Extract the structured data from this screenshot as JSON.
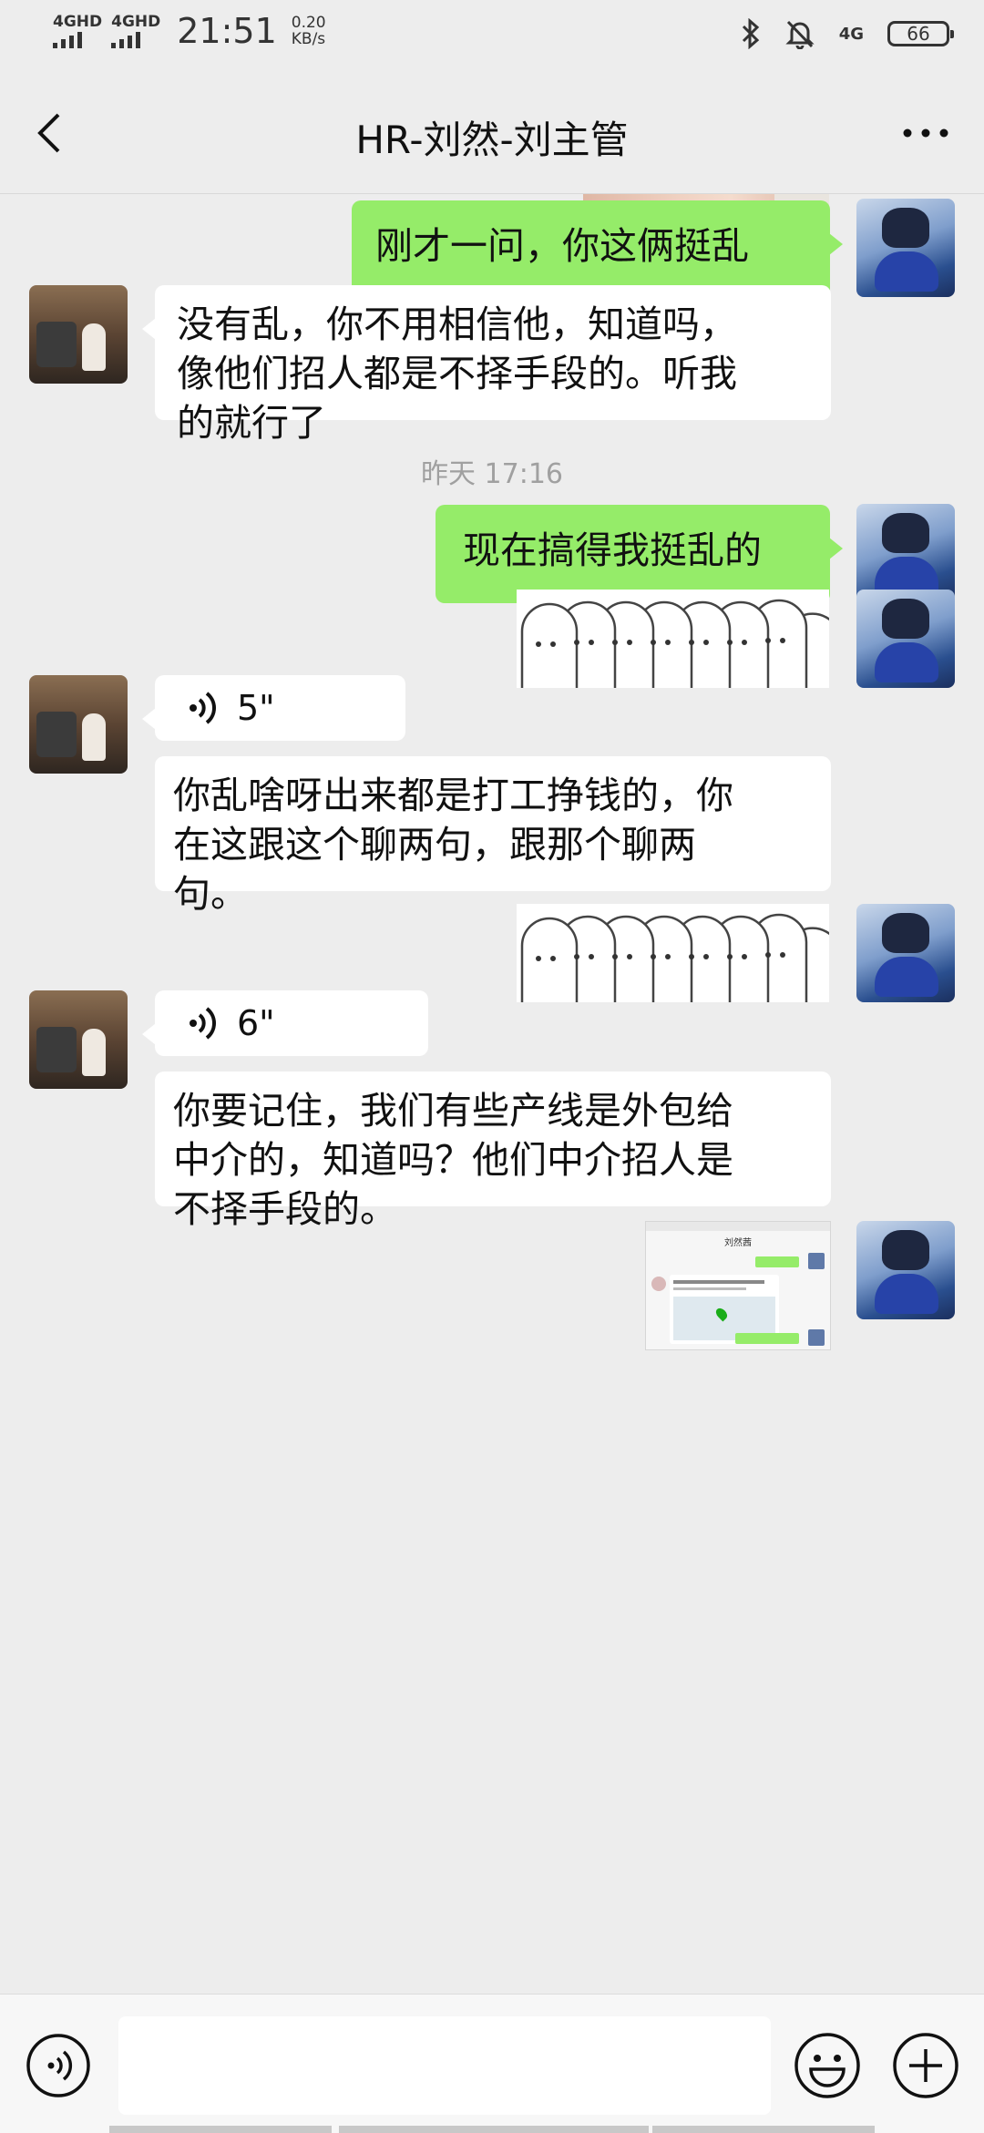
{
  "status_bar": {
    "sim1": "4GHD",
    "sim2": "4GHD",
    "time": "21:51",
    "speed_value": "0.20",
    "speed_unit": "KB/s",
    "net_type": "4G",
    "battery": "66",
    "icons": [
      "bluetooth-icon",
      "mute-bell-icon"
    ]
  },
  "header": {
    "title": "HR-刘然-刘主管",
    "back_icon": "chevron-left-icon",
    "more_icon": "more-dots-icon"
  },
  "messages": [
    {
      "from": "me",
      "type": "image",
      "desc": "photo"
    },
    {
      "from": "me",
      "type": "text",
      "text": "刚才一问，你这俩挺乱"
    },
    {
      "from": "them",
      "type": "text",
      "lines": [
        "没有乱，你不用相信他，知道吗，",
        "像他们招人都是不择手段的。听我",
        "的就行了"
      ]
    },
    {
      "from": "system",
      "type": "time",
      "text": "昨天 17:16"
    },
    {
      "from": "me",
      "type": "text",
      "text": "现在搞得我挺乱的"
    },
    {
      "from": "me",
      "type": "sticker"
    },
    {
      "from": "them",
      "type": "voice",
      "duration": "5\""
    },
    {
      "from": "them",
      "type": "text",
      "lines": [
        "你乱啥呀出来都是打工挣钱的，你",
        "在这跟这个聊两句，跟那个聊两",
        "句。"
      ]
    },
    {
      "from": "me",
      "type": "sticker"
    },
    {
      "from": "them",
      "type": "voice",
      "duration": "6\""
    },
    {
      "from": "them",
      "type": "text",
      "lines": [
        "你要记住，我们有些产线是外包给",
        "中介的，知道吗？他们中介招人是",
        "不择手段的。"
      ]
    },
    {
      "from": "me",
      "type": "image",
      "desc": "screenshot",
      "inner_title": "刘然茜"
    }
  ],
  "input_bar": {
    "voice_icon": "voice-input-icon",
    "emoji_icon": "emoji-icon",
    "plus_icon": "plus-icon",
    "placeholder": ""
  },
  "colors": {
    "bg": "#ededed",
    "me_bubble": "#95ec69",
    "them_bubble": "#ffffff"
  }
}
